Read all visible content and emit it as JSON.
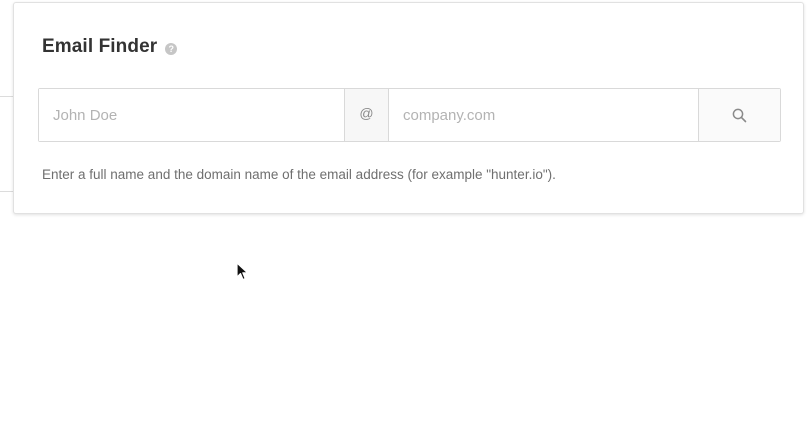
{
  "finder": {
    "title": "Email Finder",
    "help_glyph": "?",
    "name_placeholder": "John Doe",
    "at_symbol": "@",
    "domain_placeholder": "company.com",
    "search_icon": "search-icon",
    "hint": "Enter a full name and the domain name of the email address (for example \"hunter.io\")."
  },
  "colors": {
    "title": "#333333",
    "border": "#d9d9d9",
    "placeholder": "#b3b3b3",
    "hint": "#6f6f6f",
    "icon": "#8a8a8a"
  }
}
